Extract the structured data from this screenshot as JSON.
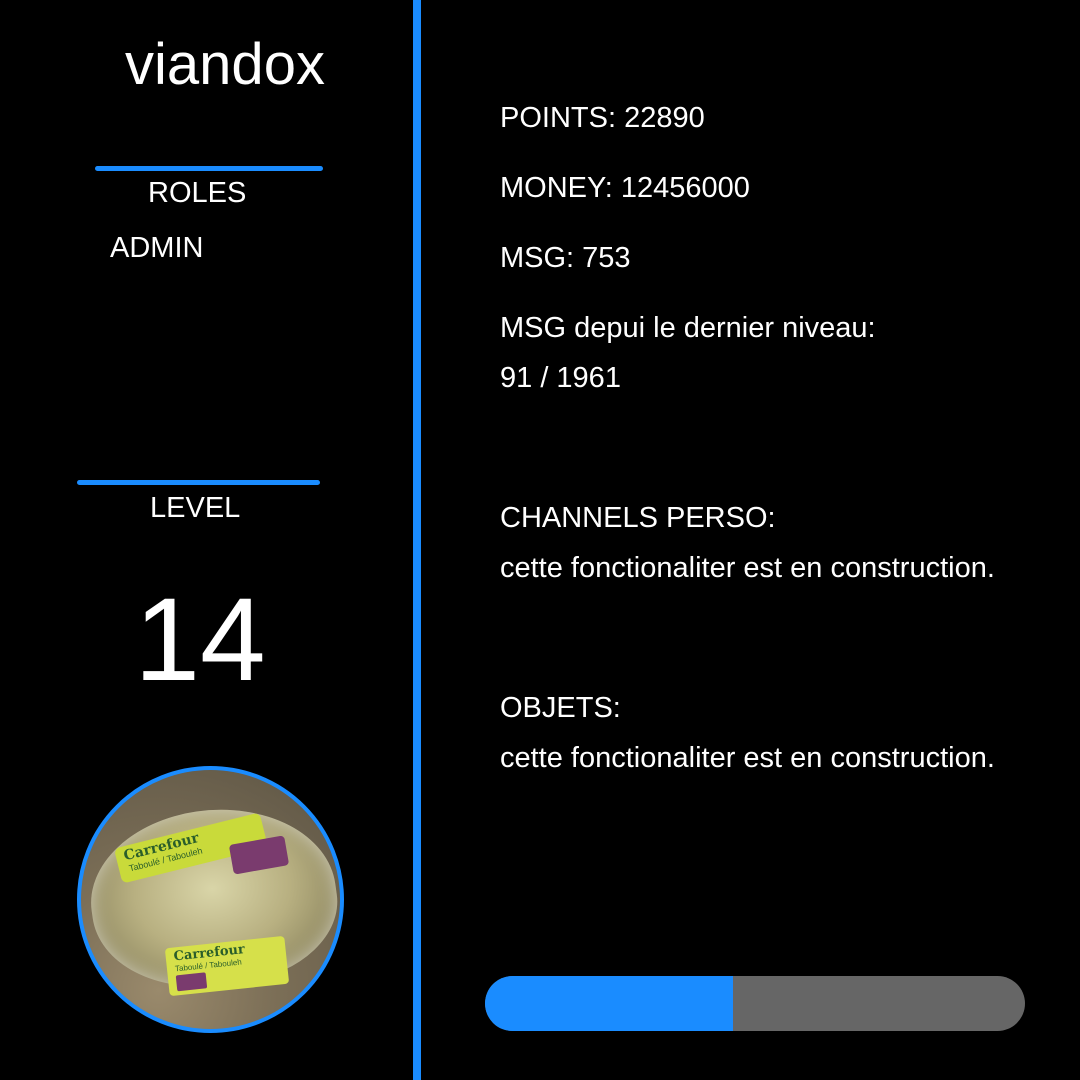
{
  "profile": {
    "username": "viandox",
    "roles_title": "ROLES",
    "roles": [
      "ADMIN"
    ],
    "level_title": "LEVEL",
    "level": "14",
    "avatar": {
      "icon": "profile-picture",
      "brand_text": "Carrefour",
      "product_text": "Taboulé / Tabouleh"
    }
  },
  "stats": {
    "points": "POINTS: 22890",
    "money": "MONEY: 12456000",
    "msg": "MSG: 753",
    "msg_since_level_label": "MSG depui le dernier niveau:",
    "msg_since_level_value": "91 / 1961",
    "channels_label": "CHANNELS PERSO:",
    "channels_text": "cette fonctionaliter est en construction.",
    "objects_label": "OBJETS:",
    "objects_text": "cette fonctionaliter est en construction."
  },
  "progress": {
    "fraction": 0.46
  },
  "colors": {
    "accent": "#1a8cff",
    "background": "#000000",
    "progress_track": "#666666",
    "text": "#ffffff"
  }
}
